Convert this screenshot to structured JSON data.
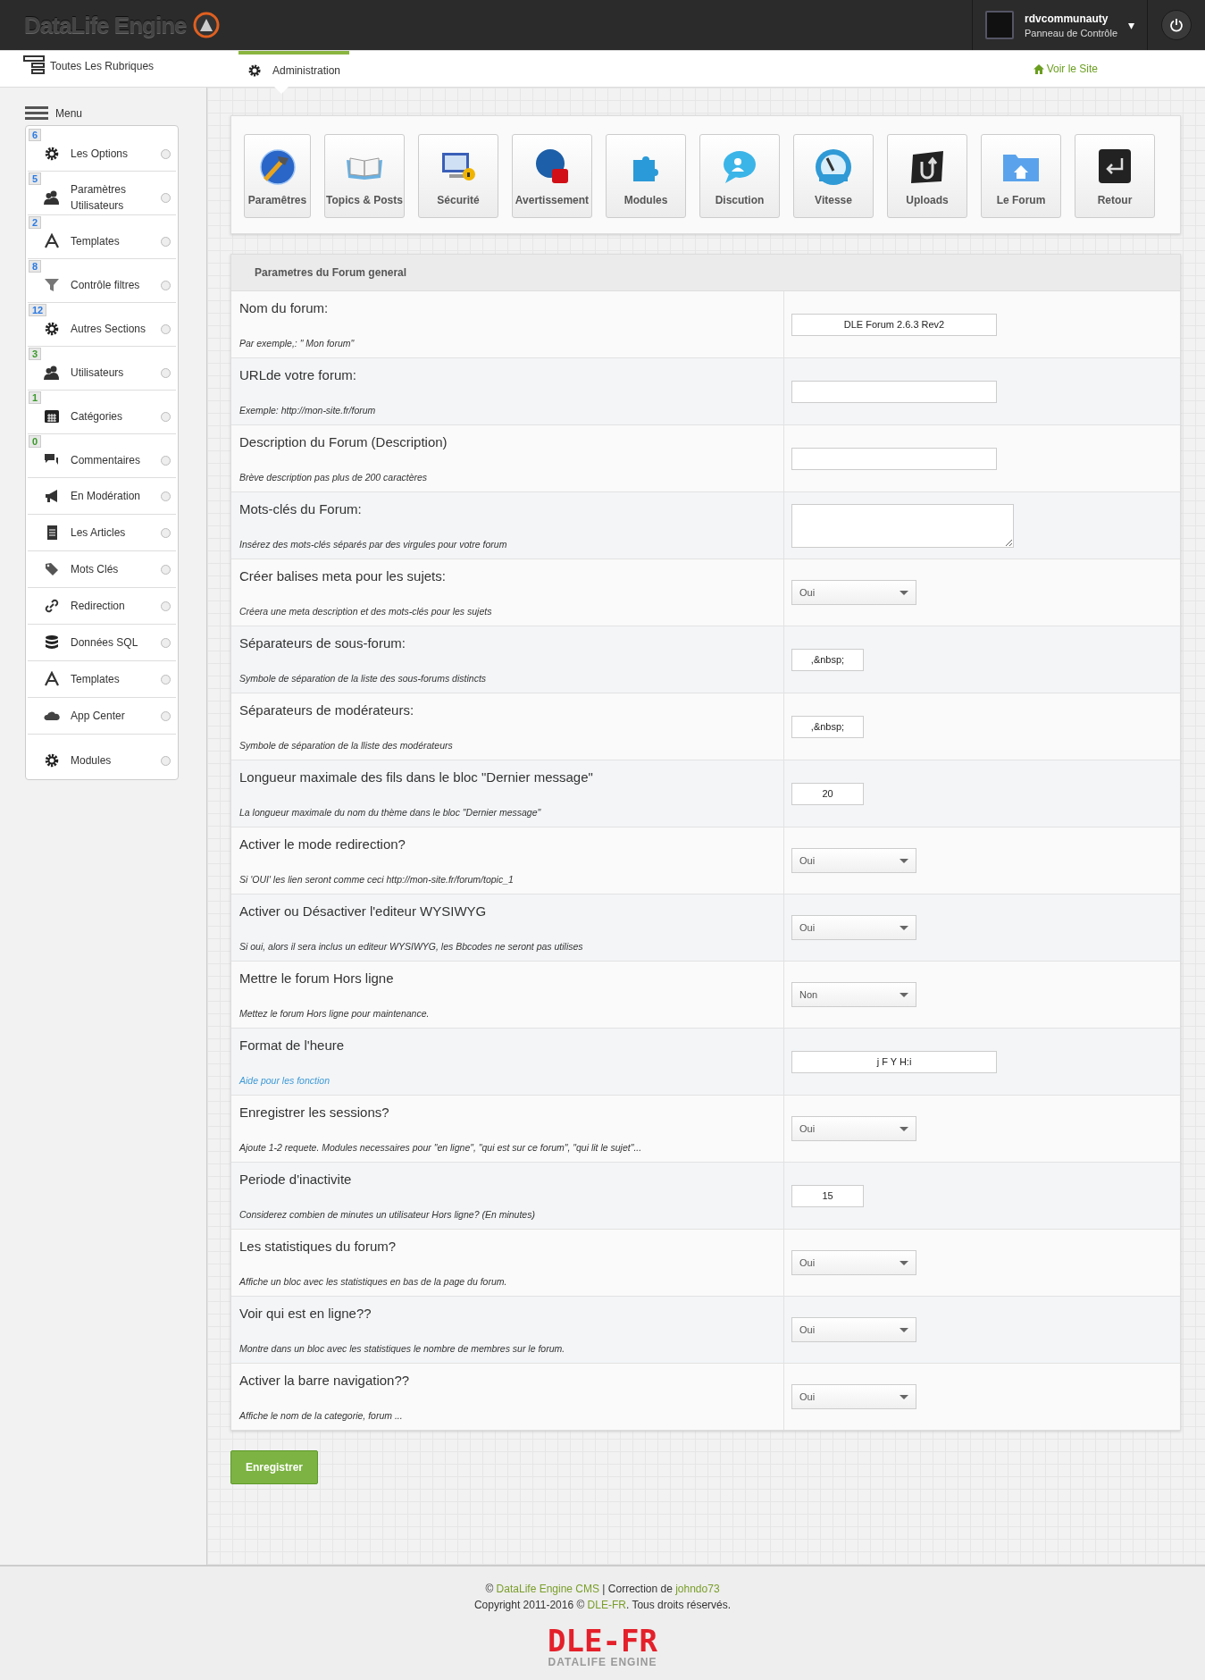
{
  "header": {
    "logo": "DataLife Engine",
    "user": {
      "name": "rdvcommunauty",
      "role": "Panneau de Contrôle",
      "caret": "▾"
    }
  },
  "nav": {
    "all": "Toutes Les Rubriques",
    "tabs": [
      {
        "label": "Administration",
        "selected": true
      }
    ],
    "site_link": "Voir le Site"
  },
  "sidebar": {
    "title": "Menu",
    "items": [
      {
        "label": "Les Options",
        "badge": {
          "text": "6",
          "color": "#2a7ae2"
        }
      },
      {
        "label": "Paramètres Utilisateurs",
        "badge": {
          "text": "5",
          "color": "#2a7ae2"
        }
      },
      {
        "label": "Templates",
        "badge": {
          "text": "2",
          "color": "#2a7ae2"
        }
      },
      {
        "label": "Contrôle filtres",
        "badge": {
          "text": "8",
          "color": "#2a7ae2"
        }
      },
      {
        "label": "Autres Sections",
        "badge": {
          "text": "12",
          "color": "#2a7ae2"
        }
      },
      {
        "label": "Utilisateurs",
        "badge": {
          "text": "3",
          "color": "#3a9a2a"
        }
      },
      {
        "label": "Catégories",
        "badge": {
          "text": "1",
          "color": "#3a9a2a"
        }
      },
      {
        "label": "Commentaires",
        "badge": {
          "text": "0",
          "color": "#3a9a2a"
        }
      },
      {
        "label": "En Modération"
      },
      {
        "label": "Les Articles"
      },
      {
        "label": "Mots Clés"
      },
      {
        "label": "Redirection"
      },
      {
        "label": "Données SQL"
      },
      {
        "label": "Templates"
      },
      {
        "label": "App Center"
      },
      {
        "label": "Modules"
      }
    ]
  },
  "toolbar": [
    "Paramêtres",
    "Topics & Posts",
    "Sécurité",
    "Avertissement",
    "Modules",
    "Discution",
    "Vitesse",
    "Uploads",
    "Le Forum",
    "Retour"
  ],
  "settings": {
    "title": "Parametres du Forum general",
    "rows": [
      {
        "label": "Nom du forum:",
        "hint": "Par exemple,: \" Mon forum\"",
        "hint_is_link": false,
        "kind": "input",
        "value": "DLE Forum 2.6.3 Rev2"
      },
      {
        "label": "URLde votre forum:",
        "hint": "Exemple: http://mon-site.fr/forum",
        "hint_is_link": false,
        "kind": "input"
      },
      {
        "label": "Description du Forum (Description)",
        "hint": "Brève description pas plus de 200 caractères",
        "hint_is_link": false,
        "kind": "input"
      },
      {
        "label": "Mots-clés du Forum:",
        "hint": "Insérez des mots-clés séparés par des virgules pour votre forum",
        "hint_is_link": false,
        "kind": "textarea"
      },
      {
        "label": "Créer balises meta pour les sujets:",
        "hint": "Créera une meta description et des mots-clés pour les sujets",
        "hint_is_link": false,
        "kind": "select",
        "value": "Oui"
      },
      {
        "label": "Séparateurs de sous-forum:",
        "hint": "Symbole de séparation de la liste des sous-forums distincts",
        "hint_is_link": false,
        "kind": "short",
        "value": ",&nbsp;"
      },
      {
        "label": "Séparateurs de modérateurs:",
        "hint": "Symbole de séparation de la lliste des modérateurs",
        "hint_is_link": false,
        "kind": "short",
        "value": ",&nbsp;"
      },
      {
        "label": "Longueur maximale des fils dans le bloc \"Dernier message\"",
        "hint": "La longueur maximale du nom du thème dans le bloc \"Dernier message\"",
        "hint_is_link": false,
        "kind": "short",
        "value": "20"
      },
      {
        "label": "Activer le mode redirection?",
        "hint": "Si 'OUI' les lien seront comme ceci http://mon-site.fr/forum/topic_1",
        "hint_is_link": false,
        "kind": "select",
        "value": "Oui"
      },
      {
        "label": "Activer ou Désactiver l'editeur WYSIWYG",
        "hint": "Si oui, alors il sera inclus un editeur WYSIWYG, les Bbcodes ne seront pas utilises",
        "hint_is_link": false,
        "kind": "select",
        "value": "Oui"
      },
      {
        "label": "Mettre le forum Hors ligne",
        "hint": "Mettez le forum Hors ligne pour maintenance.",
        "hint_is_link": false,
        "kind": "select",
        "value": "Non"
      },
      {
        "label": "Format de l'heure",
        "hint": "Aide pour les fonction",
        "hint_is_link": true,
        "kind": "input",
        "value": "j F Y H:i"
      },
      {
        "label": "Enregistrer les sessions?",
        "hint": "Ajoute 1-2 requete. Modules necessaires pour \"en ligne\", \"qui est sur ce forum\", \"qui lit le sujet\"...",
        "hint_is_link": false,
        "kind": "select",
        "value": "Oui"
      },
      {
        "label": "Periode d'inactivite",
        "hint": "Considerez combien de minutes un utilisateur Hors ligne? (En minutes)",
        "hint_is_link": false,
        "kind": "short",
        "value": "15"
      },
      {
        "label": "Les statistiques du forum?",
        "hint": "Affiche un bloc avec les statistiques en bas de la page du forum.",
        "hint_is_link": false,
        "kind": "select",
        "value": "Oui"
      },
      {
        "label": "Voir qui est en ligne??",
        "hint": "Montre dans un bloc avec les statistiques le nombre de membres sur le forum.",
        "hint_is_link": false,
        "kind": "select",
        "value": "Oui"
      },
      {
        "label": "Activer la barre navigation??",
        "hint": "Affiche le nom de la categorie, forum ...",
        "hint_is_link": false,
        "kind": "select",
        "value": "Oui"
      }
    ]
  },
  "save_button": "Enregistrer",
  "footer": {
    "line1": [
      "© ",
      {
        "link": "DataLife Engine CMS"
      },
      " | Correction de ",
      {
        "link": "johndo73"
      }
    ],
    "line2": [
      "Copyright 2011-2016 © ",
      {
        "link": "DLE-FR"
      },
      ". Tous droits réservés."
    ],
    "logo": "DLE-FR",
    "logo_sub": "DATALIFE ENGINE"
  }
}
